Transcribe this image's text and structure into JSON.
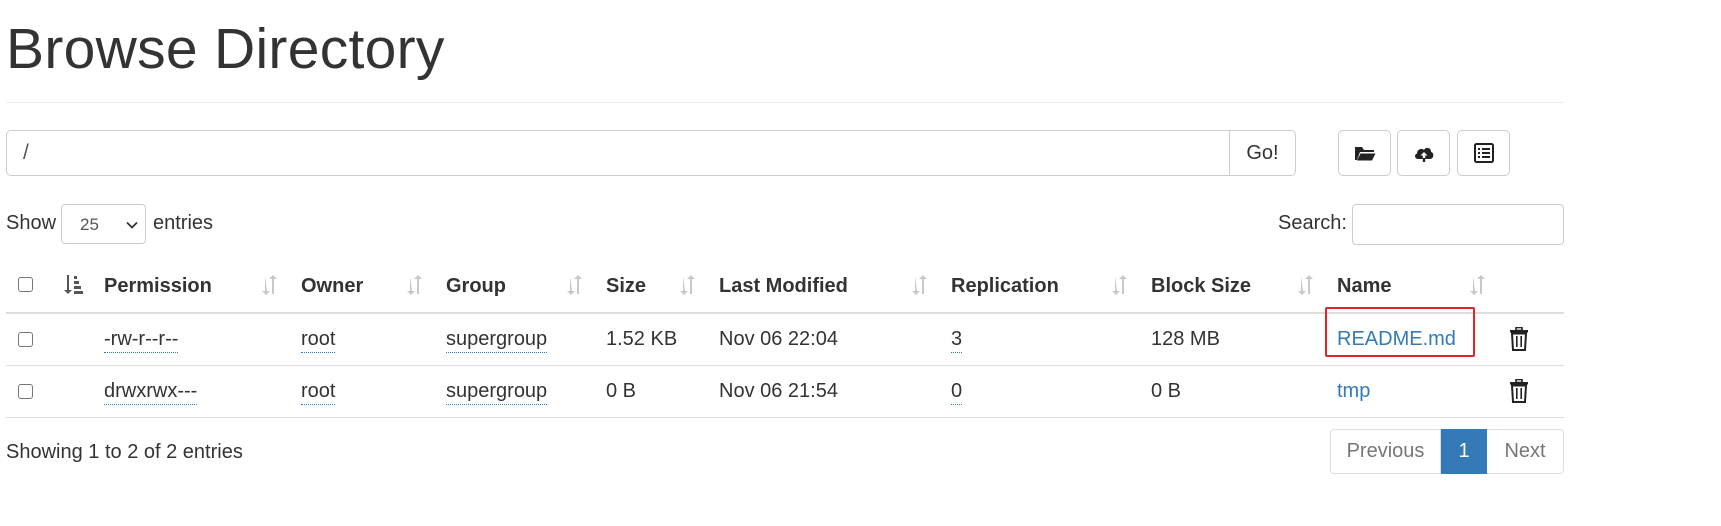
{
  "page": {
    "title": "Browse Directory"
  },
  "path_bar": {
    "value": "/",
    "go_label": "Go!"
  },
  "toolbar": {
    "buttons": [
      {
        "icon": "folder-open-icon"
      },
      {
        "icon": "cloud-upload-icon"
      },
      {
        "icon": "list-alt-icon"
      }
    ]
  },
  "table_controls": {
    "show_label": "Show",
    "page_length": "25",
    "entries_label": "entries",
    "search_label": "Search:",
    "search_value": ""
  },
  "table": {
    "columns": [
      "Permission",
      "Owner",
      "Group",
      "Size",
      "Last Modified",
      "Replication",
      "Block Size",
      "Name"
    ],
    "rows": [
      {
        "permission": "-rw-r--r--",
        "owner": "root",
        "group": "supergroup",
        "size": "1.52 KB",
        "last_modified": "Nov 06 22:04",
        "replication": "3",
        "block_size": "128 MB",
        "name": "README.md"
      },
      {
        "permission": "drwxrwx---",
        "owner": "root",
        "group": "supergroup",
        "size": "0 B",
        "last_modified": "Nov 06 21:54",
        "replication": "0",
        "block_size": "0 B",
        "name": "tmp"
      }
    ]
  },
  "footer": {
    "info": "Showing 1 to 2 of 2 entries",
    "pagination": {
      "previous": "Previous",
      "current": "1",
      "next": "Next"
    }
  },
  "colors": {
    "link": "#337ab7",
    "highlight": "#e0262d",
    "active_page": "#337ab7"
  }
}
